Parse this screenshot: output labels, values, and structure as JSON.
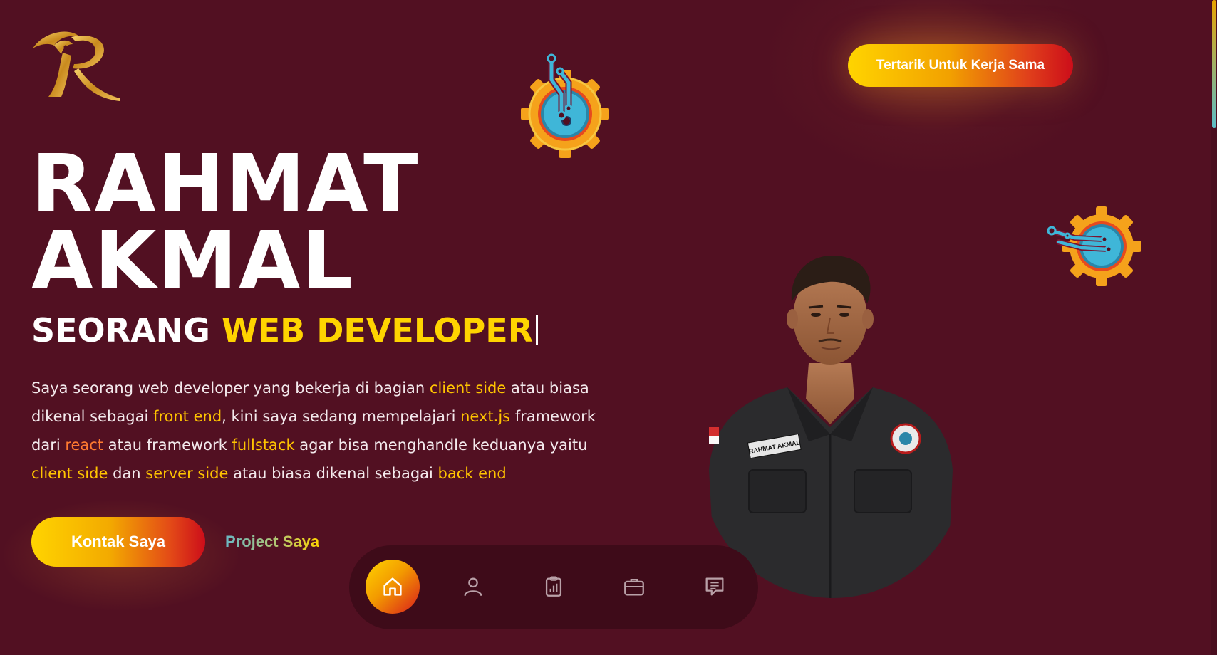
{
  "header": {
    "logo_letter": "R",
    "cta_label": "Tertarik Untuk Kerja Sama"
  },
  "hero": {
    "name_line1": "RAHMAT",
    "name_line2": "AKMAL",
    "subtitle_prefix": "SEORANG",
    "subtitle_highlight": "WEB DEVELOPER",
    "description": [
      {
        "text": "Saya seorang web developer yang bekerja di bagian ",
        "hl": ""
      },
      {
        "text": "client side",
        "hl": "hl"
      },
      {
        "text": " atau biasa dikenal sebagai ",
        "hl": ""
      },
      {
        "text": "front end",
        "hl": "hl"
      },
      {
        "text": ", kini saya sedang mempelajari ",
        "hl": ""
      },
      {
        "text": "next.js",
        "hl": "hl"
      },
      {
        "text": " framework dari ",
        "hl": ""
      },
      {
        "text": "react",
        "hl": "hl2"
      },
      {
        "text": " atau framework ",
        "hl": ""
      },
      {
        "text": "fullstack",
        "hl": "hl"
      },
      {
        "text": " agar bisa menghandle keduanya yaitu ",
        "hl": ""
      },
      {
        "text": "client side",
        "hl": "hl"
      },
      {
        "text": " dan ",
        "hl": ""
      },
      {
        "text": "server side",
        "hl": "hl"
      },
      {
        "text": " atau biasa dikenal sebagai ",
        "hl": ""
      },
      {
        "text": "back end",
        "hl": "hl"
      }
    ],
    "contact_button": "Kontak Saya",
    "project_link": "Project Saya"
  },
  "photo": {
    "name_tag": "RAHMAT AKMAL"
  },
  "nav": {
    "items": [
      {
        "icon": "home-icon",
        "active": true
      },
      {
        "icon": "user-icon",
        "active": false
      },
      {
        "icon": "clipboard-chart-icon",
        "active": false
      },
      {
        "icon": "briefcase-icon",
        "active": false
      },
      {
        "icon": "message-icon",
        "active": false
      }
    ]
  },
  "colors": {
    "background": "#521022",
    "accent_yellow": "#ffd400",
    "accent_red": "#cc0d1a",
    "gear_orange": "#f5a21b",
    "circuit_blue": "#3fb6d8"
  }
}
